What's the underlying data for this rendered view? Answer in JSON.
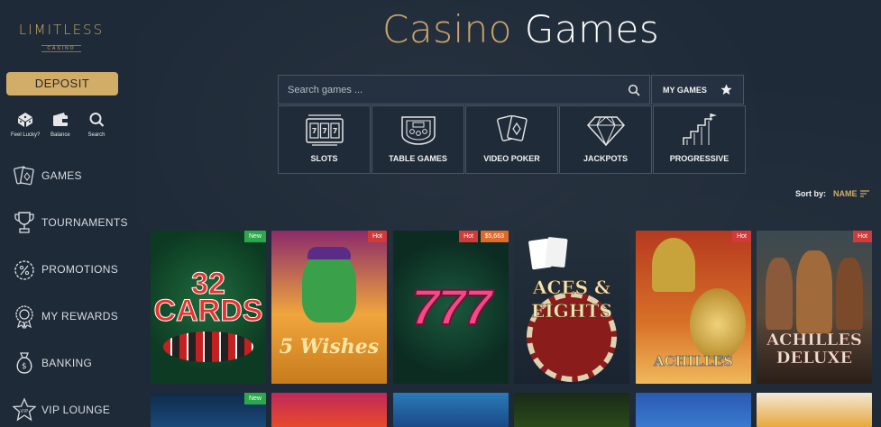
{
  "logo": {
    "brand": "LIMITLESS",
    "sub": "CASINO"
  },
  "sidebar": {
    "deposit_label": "DEPOSIT",
    "quick": [
      {
        "label": "Feel Lucky?",
        "icon": "dice-icon"
      },
      {
        "label": "Balance",
        "icon": "wallet-icon"
      },
      {
        "label": "Search",
        "icon": "search-icon"
      }
    ],
    "nav": [
      {
        "label": "GAMES",
        "icon": "cards-icon"
      },
      {
        "label": "TOURNAMENTS",
        "icon": "trophy-icon"
      },
      {
        "label": "PROMOTIONS",
        "icon": "percent-badge-icon"
      },
      {
        "label": "MY REWARDS",
        "icon": "medal-icon"
      },
      {
        "label": "BANKING",
        "icon": "money-bag-icon"
      },
      {
        "label": "VIP LOUNGE",
        "icon": "vip-star-icon"
      }
    ]
  },
  "header": {
    "title_part1": "Casino",
    "title_part2": "Games"
  },
  "search": {
    "placeholder": "Search games ..."
  },
  "my_games_label": "MY GAMES",
  "categories": [
    {
      "label": "SLOTS",
      "icon": "slot-machine-icon"
    },
    {
      "label": "TABLE GAMES",
      "icon": "roulette-table-icon"
    },
    {
      "label": "VIDEO POKER",
      "icon": "playing-cards-icon"
    },
    {
      "label": "JACKPOTS",
      "icon": "diamond-icon"
    },
    {
      "label": "PROGRESSIVE",
      "icon": "stairs-flag-icon"
    }
  ],
  "sort": {
    "label": "Sort by:",
    "value": "NAME"
  },
  "games": [
    {
      "title": "32 CARDS",
      "badges": [
        "New"
      ]
    },
    {
      "title": "5 Wishes",
      "badges": [
        "Hot"
      ]
    },
    {
      "title": "777",
      "badges": [
        "Hot",
        "$5,663"
      ]
    },
    {
      "title": "ACES & EIGHTS",
      "badges": []
    },
    {
      "title": "ACHILLES",
      "badges": [
        "Hot"
      ]
    },
    {
      "title": "ACHILLES DELUXE",
      "badges": [
        "Hot"
      ]
    }
  ],
  "games_row2_badges": [
    "New"
  ],
  "colors": {
    "background": "#1f2a38",
    "gold": "#d2ad67",
    "hot": "#d23a3a",
    "new": "#2aa84a"
  }
}
